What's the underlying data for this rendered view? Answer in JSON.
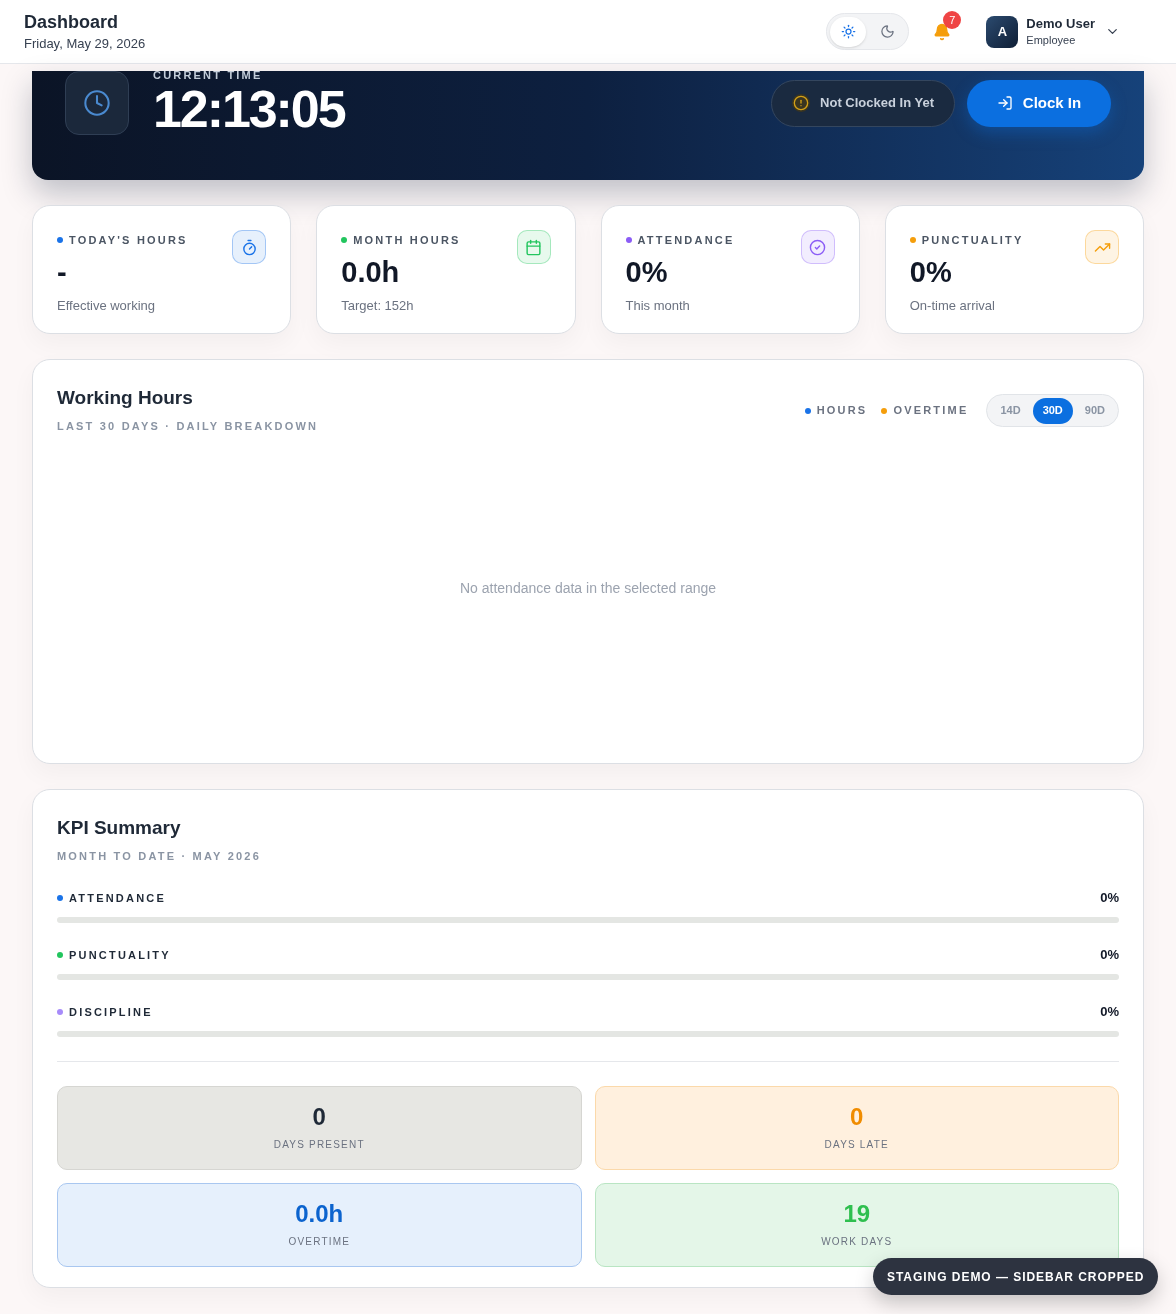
{
  "header": {
    "title": "Dashboard",
    "date": "Friday, May 29, 2026",
    "theme_toggle": [
      {
        "kind": "light",
        "selected": true
      },
      {
        "kind": "dark",
        "selected": false
      }
    ],
    "notifications": {
      "count": "7"
    },
    "user": {
      "initial": "A",
      "name": "Demo User",
      "role": "Employee"
    }
  },
  "clock_panel": {
    "label": "CURRENT TIME",
    "time": "12:13:05",
    "status": "Not Clocked In Yet",
    "action": "Clock In"
  },
  "stat_cards": [
    {
      "label": "TODAY'S HOURS",
      "value": "-",
      "caption": "Effective working",
      "color": "#1a73e8",
      "kind": "timer"
    },
    {
      "label": "MONTH HOURS",
      "value": "0.0h",
      "caption": "Target: 152h",
      "color": "#22c55e",
      "kind": "calendar"
    },
    {
      "label": "ATTENDANCE",
      "value": "0%",
      "caption": "This month",
      "color": "#8b5cf6",
      "kind": "check"
    },
    {
      "label": "PUNCTUALITY",
      "value": "0%",
      "caption": "On-time arrival",
      "color": "#f59e0b",
      "kind": "trend"
    }
  ],
  "working_hours": {
    "title": "Working Hours",
    "subtitle": "LAST 30 DAYS · DAILY BREAKDOWN",
    "legend": [
      {
        "label": "HOURS",
        "color": "#1a73e8"
      },
      {
        "label": "OVERTIME",
        "color": "#f59e0b"
      }
    ],
    "ranges": [
      {
        "label": "14D",
        "selected": false
      },
      {
        "label": "30D",
        "selected": true
      },
      {
        "label": "90D",
        "selected": false
      }
    ],
    "empty_message": "No attendance data in the selected range"
  },
  "kpi_summary": {
    "title": "KPI Summary",
    "subtitle": "MONTH TO DATE · MAY 2026",
    "metrics": [
      {
        "label": "ATTENDANCE",
        "value": "0%",
        "level": 0,
        "color": "#1a73e8"
      },
      {
        "label": "PUNCTUALITY",
        "value": "0%",
        "level": 0,
        "color": "#22c55e"
      },
      {
        "label": "DISCIPLINE",
        "value": "0%",
        "level": 0,
        "color": "#a78bfa"
      }
    ],
    "tiles": [
      {
        "kind": "neutral",
        "value": "0",
        "label": "DAYS PRESENT"
      },
      {
        "kind": "warning",
        "value": "0",
        "label": "DAYS LATE"
      },
      {
        "kind": "info",
        "value": "0.0h",
        "label": "OVERTIME"
      },
      {
        "kind": "success",
        "value": "19",
        "label": "WORK DAYS"
      }
    ]
  },
  "overlay_badge": {
    "text": "STAGING DEMO — SIDEBAR CROPPED"
  }
}
